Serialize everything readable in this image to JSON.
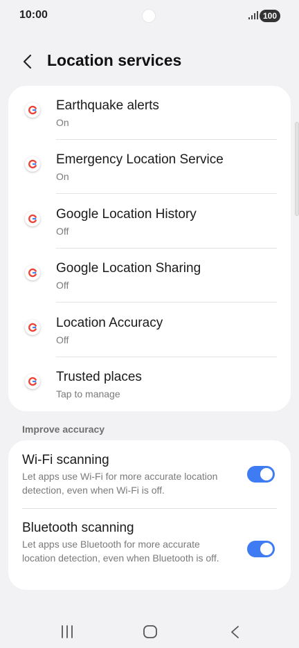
{
  "status": {
    "time": "10:00",
    "battery": "100"
  },
  "header": {
    "title": "Location services"
  },
  "google_items": [
    {
      "title": "Earthquake alerts",
      "subtitle": "On"
    },
    {
      "title": "Emergency Location Service",
      "subtitle": "On"
    },
    {
      "title": "Google Location History",
      "subtitle": "Off"
    },
    {
      "title": "Google Location Sharing",
      "subtitle": "Off"
    },
    {
      "title": "Location Accuracy",
      "subtitle": "Off"
    },
    {
      "title": "Trusted places",
      "subtitle": "Tap to manage"
    }
  ],
  "improve": {
    "label": "Improve accuracy",
    "wifi": {
      "title": "Wi-Fi scanning",
      "desc": "Let apps use Wi-Fi for more accurate location detection, even when Wi-Fi is off.",
      "enabled": true
    },
    "bluetooth": {
      "title": "Bluetooth scanning",
      "desc": "Let apps use Bluetooth for more accurate location detection, even when Bluetooth is off.",
      "enabled": true
    }
  },
  "colors": {
    "accent": "#3f7bf2",
    "background": "#f2f2f4",
    "card": "#ffffff"
  },
  "icons": [
    "signal-icon",
    "battery-icon",
    "back-arrow-icon",
    "google-icon",
    "recents-icon",
    "home-icon",
    "nav-back-icon"
  ]
}
